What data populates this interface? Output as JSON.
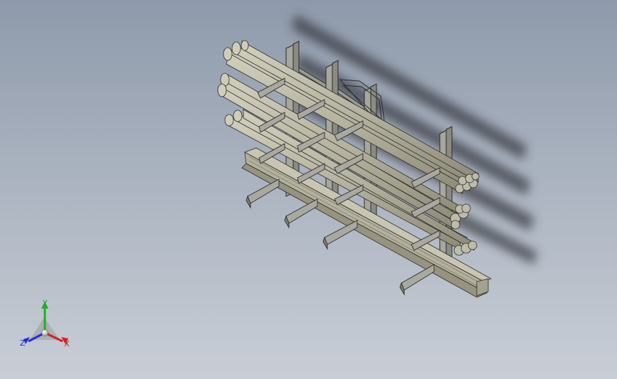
{
  "viewport": {
    "background_top": "#8e9aab",
    "background_bottom": "#c9ced6",
    "model": "cantilever-rack-with-pipes"
  },
  "triad": {
    "x_label": "X",
    "y_label": "Y",
    "z_label": "Z",
    "x_color": "#d42020",
    "y_color": "#20b020",
    "z_color": "#2030d0"
  },
  "colors": {
    "pipe_fill": "#b9b7a3",
    "pipe_shade": "#8f8d7a",
    "steel_fill": "#a9a9a0",
    "outline": "#2b2b2b",
    "shadow": "#3a3e45"
  }
}
